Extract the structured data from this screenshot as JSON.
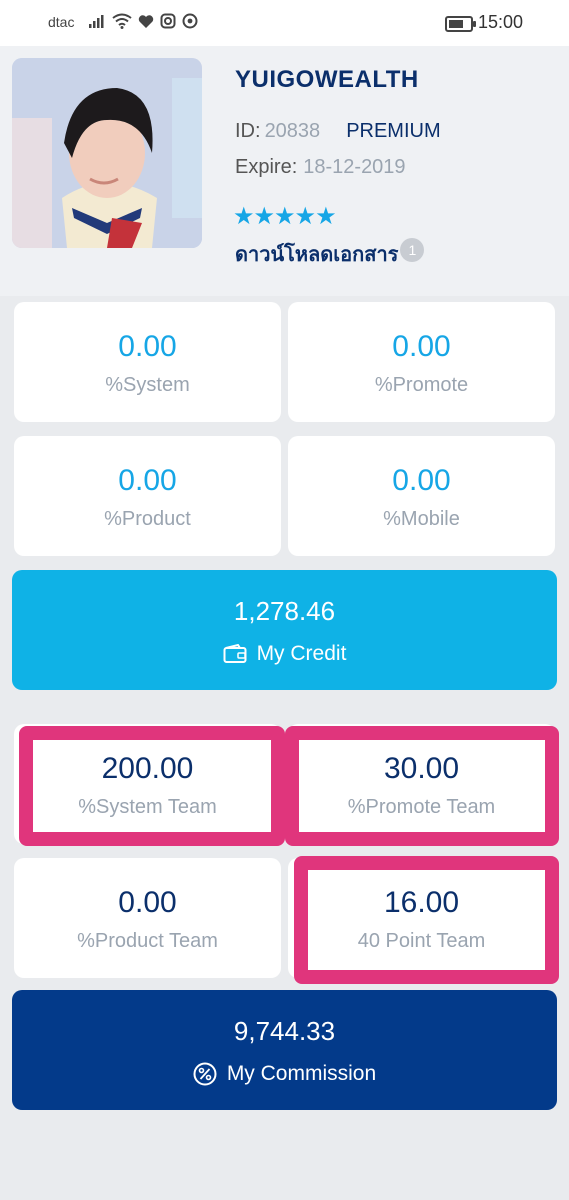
{
  "status_bar": {
    "carrier": "dtac",
    "time": "15:00",
    "icons": [
      "signal-icon",
      "wifi-icon",
      "heart-icon",
      "instagram-icon",
      "chrome-icon",
      "battery-icon"
    ]
  },
  "profile": {
    "username": "YUIGOWEALTH",
    "id_label": "ID:",
    "id_value": "20838",
    "plan": "PREMIUM",
    "expire_label": "Expire:",
    "expire_value": "18-12-2019",
    "stars": "★★★★★",
    "rating_stars": 5,
    "download_label": "ดาวน์โหลดเอกสาร",
    "download_badge": "1"
  },
  "stats": [
    {
      "value": "0.00",
      "label": "%System"
    },
    {
      "value": "0.00",
      "label": "%Promote"
    },
    {
      "value": "0.00",
      "label": "%Product"
    },
    {
      "value": "0.00",
      "label": "%Mobile"
    }
  ],
  "credit": {
    "value": "1,278.46",
    "label": "My Credit",
    "icon": "wallet-icon",
    "color": "#0fb2e6"
  },
  "team_stats": [
    {
      "value": "200.00",
      "label": "%System Team"
    },
    {
      "value": "30.00",
      "label": "%Promote Team"
    },
    {
      "value": "0.00",
      "label": "%Product Team"
    },
    {
      "value": "16.00",
      "label": "40 Point Team"
    }
  ],
  "commission": {
    "value": "9,744.33",
    "label": "My Commission",
    "icon": "percent-icon",
    "color": "#033a8a"
  },
  "colors": {
    "accent_light": "#16a6e6",
    "accent_dark": "#0b2f6b",
    "highlight": "#e0357c",
    "background": "#e9ebee"
  }
}
